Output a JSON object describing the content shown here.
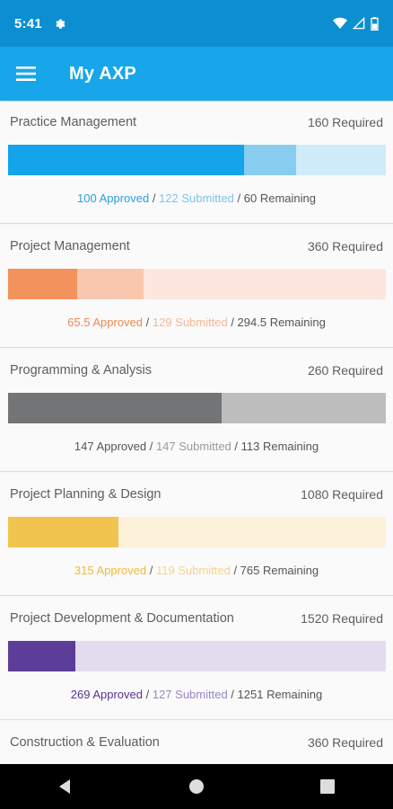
{
  "status_bar": {
    "time": "5:41"
  },
  "app_bar": {
    "title": "My AXP"
  },
  "sections": [
    {
      "name": "Practice Management",
      "required": "160 Required",
      "approved": 100,
      "submitted": 122,
      "approved_text": "100 Approved",
      "submitted_text": "122 Submitted",
      "remaining_text": "60 Remaining",
      "total": 160,
      "colors": {
        "approved": "#13a4e9",
        "submitted": "#88cdef",
        "remaining": "#d0ebf9",
        "approved_text": "#2a9fdc",
        "submitted_text": "#7fc4ea"
      }
    },
    {
      "name": "Project Management",
      "required": "360 Required",
      "approved": 65.5,
      "submitted": 129,
      "approved_text": "65.5 Approved",
      "submitted_text": "129 Submitted",
      "remaining_text": "294.5 Remaining",
      "total": 360,
      "colors": {
        "approved": "#f2925c",
        "submitted": "#f8c7ae",
        "remaining": "#fde6dd",
        "approved_text": "#f08a4f",
        "submitted_text": "#f5b896"
      }
    },
    {
      "name": "Programming & Analysis",
      "required": "260 Required",
      "approved": 147,
      "submitted": 147,
      "approved_text": "147 Approved",
      "submitted_text": "147 Submitted",
      "remaining_text": "113 Remaining",
      "total": 260,
      "colors": {
        "approved": "#737476",
        "submitted": "#bcbcbd",
        "remaining": "#bdbdbd",
        "approved_text": "#555555",
        "submitted_text": "#9a9a9a"
      }
    },
    {
      "name": "Project Planning & Design",
      "required": "1080 Required",
      "approved": 315,
      "submitted": 119,
      "approved_text": "315 Approved",
      "submitted_text": "119 Submitted",
      "remaining_text": "765 Remaining",
      "total": 1080,
      "colors": {
        "approved": "#f0c44e",
        "submitted": "#f8df9f",
        "remaining": "#fdf1d9",
        "approved_text": "#eebb3a",
        "submitted_text": "#f5d58a"
      }
    },
    {
      "name": "Project Development & Documentation",
      "required": "1520 Required",
      "approved": 269,
      "submitted": 127,
      "approved_text": "269 Approved",
      "submitted_text": "127 Submitted",
      "remaining_text": "1251 Remaining",
      "total": 1520,
      "colors": {
        "approved": "#5c3e99",
        "submitted": "#a999cd",
        "remaining": "#e2ddee",
        "approved_text": "#54378f",
        "submitted_text": "#9b88c6"
      }
    },
    {
      "name": "Construction & Evaluation",
      "required": "360 Required",
      "approved": 0,
      "submitted": 0,
      "approved_text": "",
      "submitted_text": "",
      "remaining_text": "",
      "total": 360,
      "colors": {
        "approved": "#19a3a0",
        "submitted": "#9fdbd8",
        "remaining": "#e0f3f2",
        "approved_text": "#19a3a0",
        "submitted_text": "#9fdbd8"
      }
    }
  ]
}
